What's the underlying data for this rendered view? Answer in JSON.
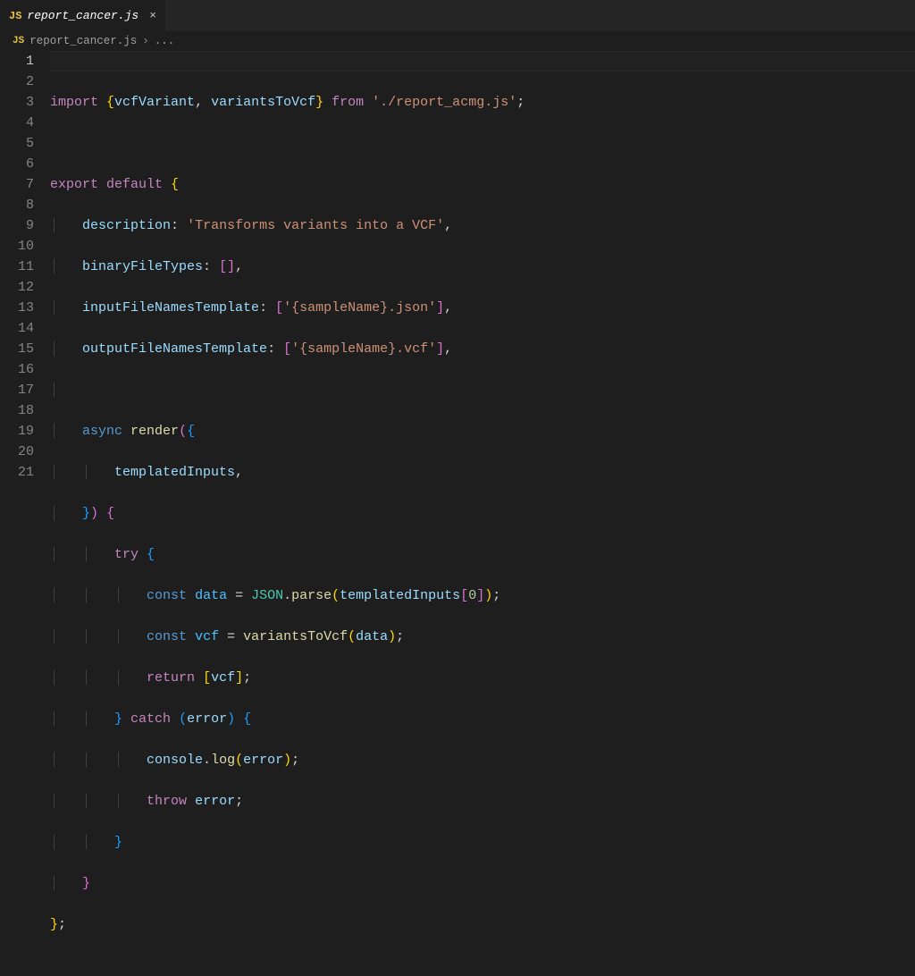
{
  "tab": {
    "icon_label": "JS",
    "filename": "report_cancer.js",
    "close_glyph": "×"
  },
  "breadcrumb": {
    "icon_label": "JS",
    "filename": "report_cancer.js",
    "chevron": "›",
    "more": "..."
  },
  "gutter": {
    "lines": [
      "1",
      "2",
      "3",
      "4",
      "5",
      "6",
      "7",
      "8",
      "9",
      "10",
      "11",
      "12",
      "13",
      "14",
      "15",
      "16",
      "17",
      "18",
      "19",
      "20",
      "21"
    ],
    "active_line": 1
  },
  "code": {
    "l1": {
      "import": "import",
      "lbrace": "{",
      "id1": "vcfVariant",
      "comma": ", ",
      "id2": "variantsToVcf",
      "rbrace": "}",
      "from": "from",
      "str": "'./report_acmg.js'",
      "semi": ";"
    },
    "l3": {
      "export": "export",
      "default": "default",
      "lbrace": "{"
    },
    "l4": {
      "key": "description",
      "colon": ": ",
      "str": "'Transforms variants into a VCF'",
      "comma": ","
    },
    "l5": {
      "key": "binaryFileTypes",
      "colon": ": ",
      "arr": "[]",
      "comma": ","
    },
    "l6": {
      "key": "inputFileNamesTemplate",
      "colon": ": ",
      "lb": "[",
      "str": "'{sampleName}.json'",
      "rb": "]",
      "comma": ","
    },
    "l7": {
      "key": "outputFileNamesTemplate",
      "colon": ": ",
      "lb": "[",
      "str": "'{sampleName}.vcf'",
      "rb": "]",
      "comma": ","
    },
    "l9": {
      "async": "async",
      "render": "render",
      "lparen": "(",
      "lbrace": "{"
    },
    "l10": {
      "id": "templatedInputs",
      "comma": ","
    },
    "l11": {
      "rbrace": "}",
      "rparen": ")",
      "lbrace": "{"
    },
    "l12": {
      "try": "try",
      "lbrace": "{"
    },
    "l13": {
      "const": "const",
      "id": "data",
      "eq": " = ",
      "json": "JSON",
      "dot": ".",
      "parse": "parse",
      "lparen": "(",
      "arg": "templatedInputs",
      "lb": "[",
      "zero": "0",
      "rb": "]",
      "rparen": ")",
      "semi": ";"
    },
    "l14": {
      "const": "const",
      "id": "vcf",
      "eq": " = ",
      "fn": "variantsToVcf",
      "lparen": "(",
      "arg": "data",
      "rparen": ")",
      "semi": ";"
    },
    "l15": {
      "return": "return",
      "lb": "[",
      "id": "vcf",
      "rb": "]",
      "semi": ";"
    },
    "l16": {
      "rbrace": "}",
      "catch": "catch",
      "lparen": "(",
      "err": "error",
      "rparen": ")",
      "lbrace": "{"
    },
    "l17": {
      "console": "console",
      "dot": ".",
      "log": "log",
      "lparen": "(",
      "err": "error",
      "rparen": ")",
      "semi": ";"
    },
    "l18": {
      "throw": "throw",
      "err": "error",
      "semi": ";"
    },
    "l19": {
      "rbrace": "}"
    },
    "l20": {
      "rbrace": "}"
    },
    "l21": {
      "rbrace": "}",
      "semi": ";"
    }
  }
}
